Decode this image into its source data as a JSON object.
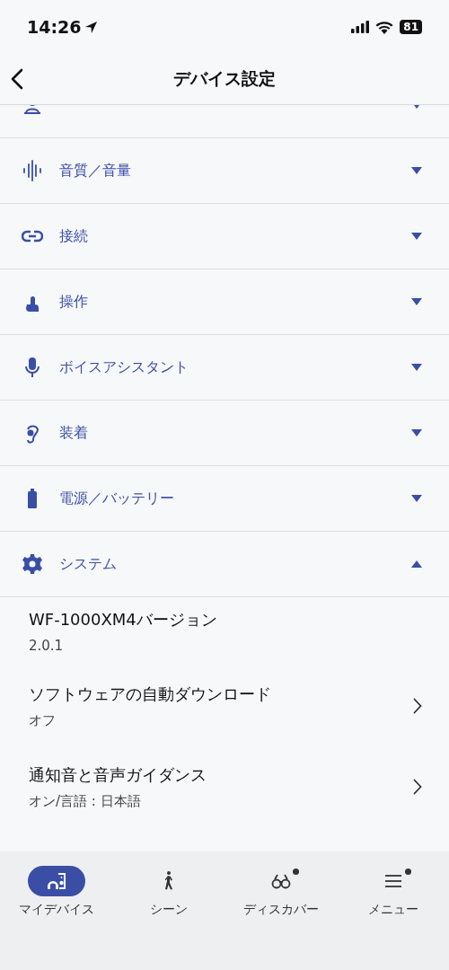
{
  "status_bar": {
    "time": "14:26",
    "battery": "81"
  },
  "header": {
    "title": "デバイス設定"
  },
  "sections": [
    {
      "expanded": false
    },
    {
      "label": "音質／音量",
      "expanded": false
    },
    {
      "label": "接続",
      "expanded": false
    },
    {
      "label": "操作",
      "expanded": false
    },
    {
      "label": "ボイスアシスタント",
      "expanded": false
    },
    {
      "label": "装着",
      "expanded": false
    },
    {
      "label": "電源／バッテリー",
      "expanded": false
    },
    {
      "label": "システム",
      "expanded": true,
      "items": [
        {
          "kind": "info",
          "title": "WF-1000XM4バージョン",
          "value": "2.0.1"
        },
        {
          "kind": "link",
          "title": "ソフトウェアの自動ダウンロード",
          "value": "オフ"
        },
        {
          "kind": "link",
          "title": "通知音と音声ガイダンス",
          "value": "オン/言語 : 日本語"
        }
      ]
    }
  ],
  "tabs": [
    {
      "label": "マイデバイス",
      "selected": true,
      "badge": false
    },
    {
      "label": "シーン",
      "selected": false,
      "badge": false
    },
    {
      "label": "ディスカバー",
      "selected": false,
      "badge": true
    },
    {
      "label": "メニュー",
      "selected": false,
      "badge": true
    }
  ]
}
